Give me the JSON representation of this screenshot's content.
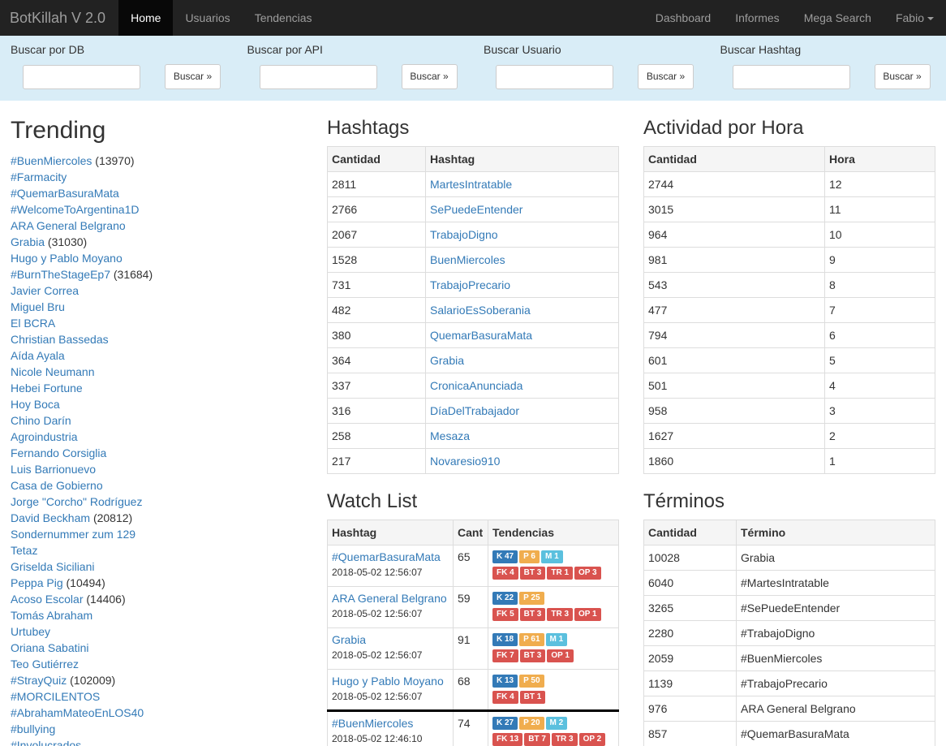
{
  "navbar": {
    "brand": "BotKillah V 2.0",
    "left_items": [
      "Home",
      "Usuarios",
      "Tendencias"
    ],
    "right_items": [
      "Dashboard",
      "Informes",
      "Mega Search",
      "Fabio"
    ]
  },
  "search": {
    "groups": [
      {
        "label": "Buscar por DB",
        "button": "Buscar »"
      },
      {
        "label": "Buscar por API",
        "button": "Buscar »"
      },
      {
        "label": "Buscar Usuario",
        "button": "Buscar »"
      },
      {
        "label": "Buscar Hashtag",
        "button": "Buscar »"
      }
    ]
  },
  "trending": {
    "title": "Trending",
    "items": [
      {
        "label": "#BuenMiercoles",
        "count": "(13970)"
      },
      {
        "label": "#Farmacity",
        "count": ""
      },
      {
        "label": "#QuemarBasuraMata",
        "count": ""
      },
      {
        "label": "#WelcomeToArgentina1D",
        "count": ""
      },
      {
        "label": "ARA General Belgrano",
        "count": ""
      },
      {
        "label": "Grabia",
        "count": "(31030)"
      },
      {
        "label": "Hugo y Pablo Moyano",
        "count": ""
      },
      {
        "label": "#BurnTheStageEp7",
        "count": "(31684)"
      },
      {
        "label": "Javier Correa",
        "count": ""
      },
      {
        "label": "Miguel Bru",
        "count": ""
      },
      {
        "label": "El BCRA",
        "count": ""
      },
      {
        "label": "Christian Bassedas",
        "count": ""
      },
      {
        "label": "Aída Ayala",
        "count": ""
      },
      {
        "label": "Nicole Neumann",
        "count": ""
      },
      {
        "label": "Hebei Fortune",
        "count": ""
      },
      {
        "label": "Hoy Boca",
        "count": ""
      },
      {
        "label": "Chino Darín",
        "count": ""
      },
      {
        "label": "Agroindustria",
        "count": ""
      },
      {
        "label": "Fernando Corsiglia",
        "count": ""
      },
      {
        "label": "Luis Barrionuevo",
        "count": ""
      },
      {
        "label": "Casa de Gobierno",
        "count": ""
      },
      {
        "label": "Jorge \"Corcho\" Rodríguez",
        "count": ""
      },
      {
        "label": "David Beckham",
        "count": "(20812)"
      },
      {
        "label": "Sondernummer zum 129",
        "count": ""
      },
      {
        "label": "Tetaz",
        "count": ""
      },
      {
        "label": "Griselda Siciliani",
        "count": ""
      },
      {
        "label": "Peppa Pig",
        "count": "(10494)"
      },
      {
        "label": "Acoso Escolar",
        "count": "(14406)"
      },
      {
        "label": "Tomás Abraham",
        "count": ""
      },
      {
        "label": "Urtubey",
        "count": ""
      },
      {
        "label": "Oriana Sabatini",
        "count": ""
      },
      {
        "label": "Teo Gutiérrez",
        "count": ""
      },
      {
        "label": "#StrayQuiz",
        "count": "(102009)"
      },
      {
        "label": "#MORCILENTOS",
        "count": ""
      },
      {
        "label": "#AbrahamMateoEnLOS40",
        "count": ""
      },
      {
        "label": "#bullying",
        "count": ""
      },
      {
        "label": "#Involucrados",
        "count": ""
      }
    ]
  },
  "hashtags": {
    "title": "Hashtags",
    "headers": [
      "Cantidad",
      "Hashtag"
    ],
    "rows": [
      [
        "2811",
        "MartesIntratable"
      ],
      [
        "2766",
        "SePuedeEntender"
      ],
      [
        "2067",
        "TrabajoDigno"
      ],
      [
        "1528",
        "BuenMiercoles"
      ],
      [
        "731",
        "TrabajoPrecario"
      ],
      [
        "482",
        "SalarioEsSoberania"
      ],
      [
        "380",
        "QuemarBasuraMata"
      ],
      [
        "364",
        "Grabia"
      ],
      [
        "337",
        "CronicaAnunciada"
      ],
      [
        "316",
        "DíaDelTrabajador"
      ],
      [
        "258",
        "Mesaza"
      ],
      [
        "217",
        "Novaresio910"
      ]
    ]
  },
  "actividad": {
    "title": "Actividad por Hora",
    "headers": [
      "Cantidad",
      "Hora"
    ],
    "rows": [
      [
        "2744",
        "12"
      ],
      [
        "3015",
        "11"
      ],
      [
        "964",
        "10"
      ],
      [
        "981",
        "9"
      ],
      [
        "543",
        "8"
      ],
      [
        "477",
        "7"
      ],
      [
        "794",
        "6"
      ],
      [
        "601",
        "5"
      ],
      [
        "501",
        "4"
      ],
      [
        "958",
        "3"
      ],
      [
        "1627",
        "2"
      ],
      [
        "1860",
        "1"
      ]
    ]
  },
  "watchlist": {
    "title": "Watch List",
    "headers": [
      "Hashtag",
      "Cant",
      "Tendencias"
    ],
    "rows": [
      {
        "hashtag": "#QuemarBasuraMata",
        "date": "2018-05-02 12:56:07",
        "cant": "65",
        "top": [
          {
            "t": "K 47",
            "c": "k"
          },
          {
            "t": "P 6",
            "c": "p"
          },
          {
            "t": "M 1",
            "c": "m"
          }
        ],
        "bottom": [
          {
            "t": "FK 4",
            "c": "r"
          },
          {
            "t": "BT 3",
            "c": "r"
          },
          {
            "t": "TR 1",
            "c": "r"
          },
          {
            "t": "OP 3",
            "c": "r"
          }
        ]
      },
      {
        "hashtag": "ARA General Belgrano",
        "date": "2018-05-02 12:56:07",
        "cant": "59",
        "top": [
          {
            "t": "K 22",
            "c": "k"
          },
          {
            "t": "P 25",
            "c": "p"
          }
        ],
        "bottom": [
          {
            "t": "FK 5",
            "c": "r"
          },
          {
            "t": "BT 3",
            "c": "r"
          },
          {
            "t": "TR 3",
            "c": "r"
          },
          {
            "t": "OP 1",
            "c": "r"
          }
        ]
      },
      {
        "hashtag": "Grabia",
        "date": "2018-05-02 12:56:07",
        "cant": "91",
        "top": [
          {
            "t": "K 18",
            "c": "k"
          },
          {
            "t": "P 61",
            "c": "p"
          },
          {
            "t": "M 1",
            "c": "m"
          }
        ],
        "bottom": [
          {
            "t": "FK 7",
            "c": "r"
          },
          {
            "t": "BT 3",
            "c": "r"
          },
          {
            "t": "OP 1",
            "c": "r"
          }
        ]
      },
      {
        "hashtag": "Hugo y Pablo Moyano",
        "date": "2018-05-02 12:56:07",
        "cant": "68",
        "top": [
          {
            "t": "K 13",
            "c": "k"
          },
          {
            "t": "P 50",
            "c": "p"
          }
        ],
        "bottom": [
          {
            "t": "FK 4",
            "c": "r"
          },
          {
            "t": "BT 1",
            "c": "r"
          }
        ]
      },
      {
        "hashtag": "#BuenMiercoles",
        "date": "2018-05-02 12:46:10",
        "cant": "74",
        "top": [
          {
            "t": "K 27",
            "c": "k"
          },
          {
            "t": "P 20",
            "c": "p"
          },
          {
            "t": "M 2",
            "c": "m"
          }
        ],
        "bottom": [
          {
            "t": "FK 13",
            "c": "r"
          },
          {
            "t": "BT 7",
            "c": "r"
          },
          {
            "t": "TR 3",
            "c": "r"
          },
          {
            "t": "OP 2",
            "c": "r"
          }
        ]
      }
    ]
  },
  "terminos": {
    "title": "Términos",
    "headers": [
      "Cantidad",
      "Término"
    ],
    "rows": [
      [
        "10028",
        "Grabia"
      ],
      [
        "6040",
        "#MartesIntratable"
      ],
      [
        "3265",
        "#SePuedeEntender"
      ],
      [
        "2280",
        "#TrabajoDigno"
      ],
      [
        "2059",
        "#BuenMiercoles"
      ],
      [
        "1139",
        "#TrabajoPrecario"
      ],
      [
        "976",
        "ARA General Belgrano"
      ],
      [
        "857",
        "#QuemarBasuraMata"
      ]
    ]
  }
}
